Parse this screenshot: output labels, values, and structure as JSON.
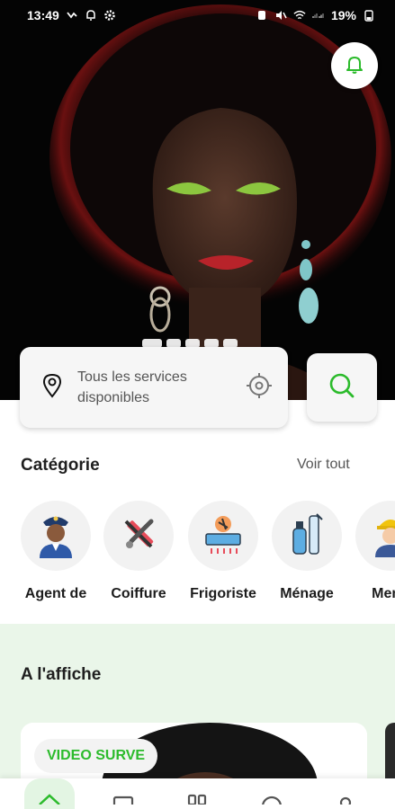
{
  "status_bar": {
    "time": "13:49",
    "battery": "19%"
  },
  "search": {
    "location_text": "Tous les services disponibles"
  },
  "categories": {
    "title": "Catégorie",
    "see_all_label": "Voir tout",
    "items": [
      {
        "label": "Agent de",
        "icon": "security-guard-icon"
      },
      {
        "label": "Coiffure",
        "icon": "hair-tools-icon"
      },
      {
        "label": "Frigoriste",
        "icon": "air-conditioner-icon"
      },
      {
        "label": "Ménage",
        "icon": "cleaning-products-icon"
      },
      {
        "label": "Menu",
        "icon": "worker-helmet-icon"
      }
    ]
  },
  "affiche": {
    "title": "A l'affiche",
    "cards": [
      {
        "badge": "VIDEO SURVE"
      }
    ]
  },
  "carousel": {
    "slide_count": 5,
    "active_index": 0
  },
  "bottom_nav": [
    {
      "icon": "home-icon",
      "active": true
    },
    {
      "icon": "shop-icon",
      "active": false
    },
    {
      "icon": "grid-icon",
      "active": false
    },
    {
      "icon": "chat-icon",
      "active": false
    },
    {
      "icon": "profile-icon",
      "active": false
    }
  ],
  "colors": {
    "accent": "#2cbb2c",
    "affiche_background": "#eaf6e9",
    "hero_background": "#040404"
  }
}
